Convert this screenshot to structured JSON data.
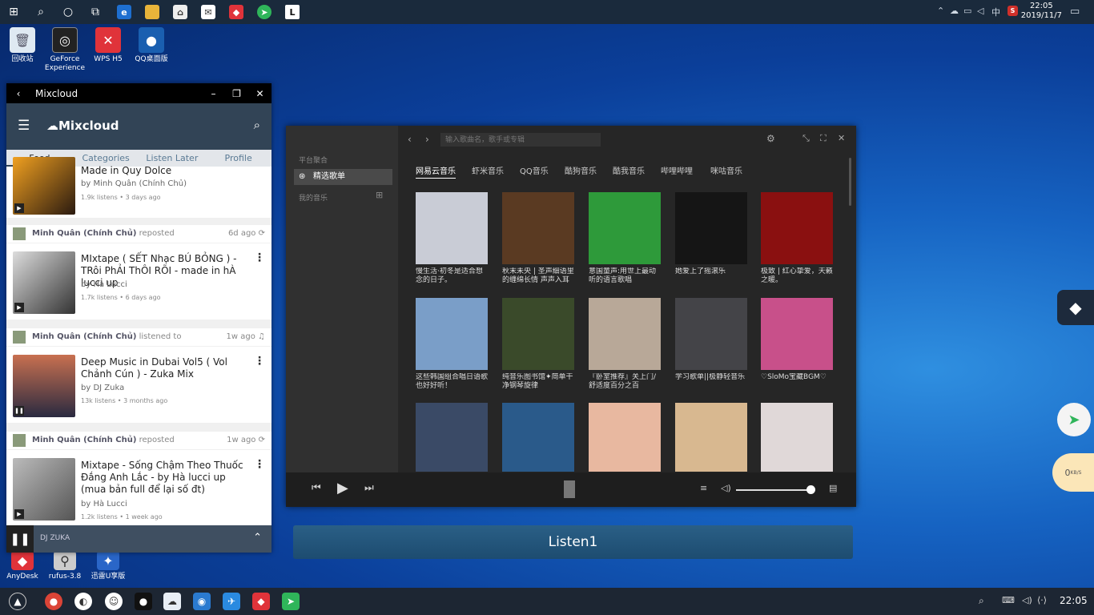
{
  "taskbar": {
    "time": "22:05",
    "date": "2019/11/7",
    "ime": "中"
  },
  "desktop_icons": [
    {
      "label": "回收站"
    },
    {
      "label": "GeForce Experience"
    },
    {
      "label": "WPS H5"
    },
    {
      "label": "QQ桌面版"
    },
    {
      "label": "AnyDesk"
    },
    {
      "label": "rufus-3.8"
    },
    {
      "label": "迅雷U享版"
    }
  ],
  "mixcloud": {
    "window_title": "Mixcloud",
    "brand": "Mixcloud",
    "tabs": [
      "Feed",
      "Categories",
      "Listen Later",
      "Profile"
    ],
    "items": [
      {
        "title": "Made in Quy Dolce",
        "by": "by Minh Quân (Chính Chủ)",
        "meta": "1.9k listens • 3 days ago"
      },
      {
        "repost_user": "Minh Quân (Chính Chủ)",
        "action": "reposted",
        "ago": "6d ago",
        "title": "MIxtape ( SẾT Nhạc BÚ BỎNG ) - TRôi PhẢI ThÔI RÕI - made in hÀ lucci up",
        "by": "by Hà Lucci",
        "meta": "1.7k listens • 6 days ago"
      },
      {
        "repost_user": "Minh Quân (Chính Chủ)",
        "action": "listened to",
        "ago": "1w ago",
        "title": "Deep Music in Dubai Vol5 ( Vol Chảnh Cún ) - Zuka Mix",
        "by": "by DJ Zuka",
        "meta": "13k listens • 3 months ago"
      },
      {
        "repost_user": "Minh Quân (Chính Chủ)",
        "action": "reposted",
        "ago": "1w ago",
        "title": "Mixtape - Sống Chậm Theo Thuốc Đắng Anh Lắc  - by Hà lucci up (mua bản full để lại số đt)",
        "by": "by Hà Lucci",
        "meta": "1.2k listens • 1 week ago"
      }
    ],
    "now_playing": "DJ ZUKA"
  },
  "listen1": {
    "search_placeholder": "输入歌曲名，歌手或专辑",
    "sidebar": {
      "section1": "平台聚合",
      "active": "精选歌单",
      "section2": "我的音乐"
    },
    "platforms": [
      "网易云音乐",
      "虾米音乐",
      "QQ音乐",
      "酷狗音乐",
      "酷我音乐",
      "哔哩哔哩",
      "咪咕音乐"
    ],
    "playlists": [
      {
        "caption": "慢生活·初冬是适合想念的日子。",
        "color": "#c9ccd6"
      },
      {
        "caption": "秋末未央 | 圣声细语里的缠绵长情 声声入耳",
        "color": "#5a3a22"
      },
      {
        "caption": "意国童声:用世上最动听的语言歌唱",
        "color": "#2e9a3a"
      },
      {
        "caption": "她爱上了摇滚乐",
        "color": "#151515"
      },
      {
        "caption": "极致 | 红心挚爱，天籁之暖。",
        "color": "#8a1010"
      },
      {
        "caption": "这些韩国组合唱日语歌也好好听！",
        "color": "#7a9ec8"
      },
      {
        "caption": "纯音乐图书馆✦简单干净钢琴旋律",
        "color": "#3a4a2a"
      },
      {
        "caption": "『卧室推荐』关上门/舒适度百分之百",
        "color": "#b8a898"
      },
      {
        "caption": "学习歌单||极静轻音乐",
        "color": "#444448"
      },
      {
        "caption": "♡SloMo宝藏BGM♡",
        "color": "#c8508a"
      },
      {
        "caption": "",
        "color": "#3a4a66"
      },
      {
        "caption": "",
        "color": "#2a5a8a"
      },
      {
        "caption": "",
        "color": "#e8b8a0"
      },
      {
        "caption": "",
        "color": "#d8b890"
      },
      {
        "caption": "",
        "color": "#e0d8d8"
      }
    ],
    "button_label": "Listen1"
  },
  "widgets": {
    "speed": "0",
    "speed_unit": "KB/S"
  }
}
